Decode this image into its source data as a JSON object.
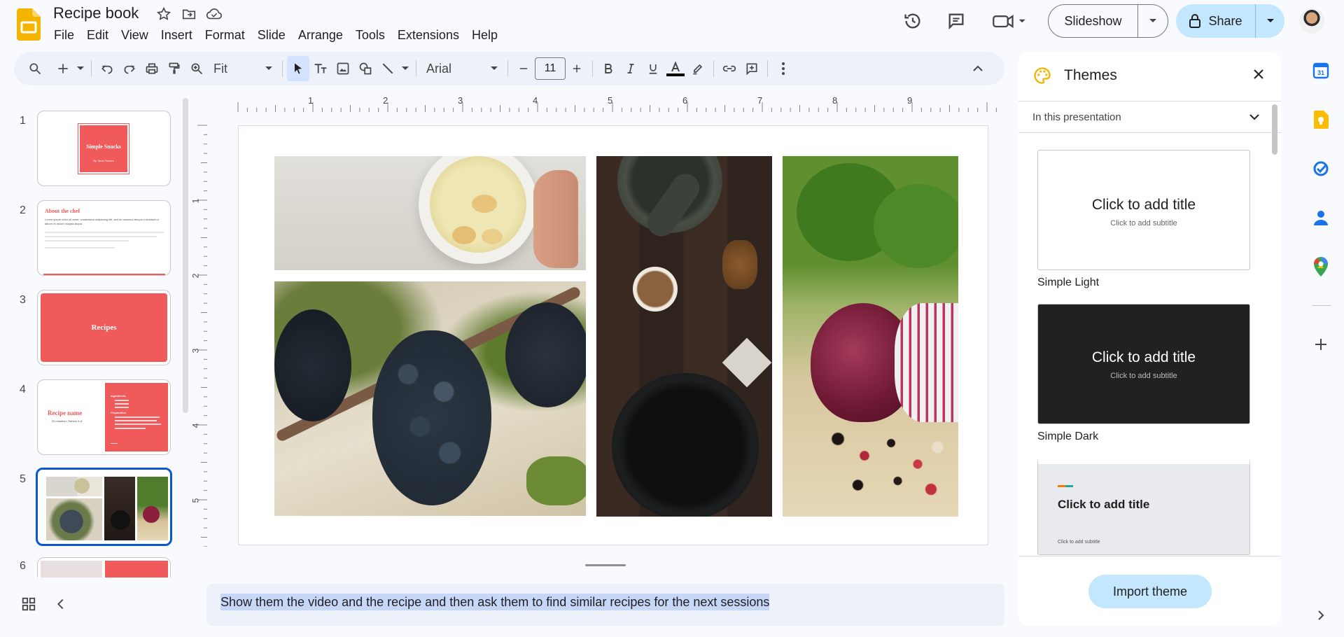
{
  "doc": {
    "title": "Recipe book"
  },
  "menu": [
    "File",
    "Edit",
    "View",
    "Insert",
    "Format",
    "Slide",
    "Arrange",
    "Tools",
    "Extensions",
    "Help"
  ],
  "header": {
    "slideshow_label": "Slideshow",
    "share_label": "Share"
  },
  "toolbar": {
    "zoom": "Fit",
    "font": "Arial",
    "font_size": "11"
  },
  "ruler": {
    "h_ticks": [
      "1",
      "2",
      "3",
      "4",
      "5",
      "6",
      "7",
      "8",
      "9"
    ],
    "v_ticks": [
      "1",
      "2",
      "3",
      "4",
      "5"
    ]
  },
  "filmstrip": {
    "slides": [
      {
        "num": "1",
        "title": "Simple Snacks",
        "sub": "By Taran Soares"
      },
      {
        "num": "2",
        "title": "About the chef",
        "body": "Lorem ipsum dolor sit amet, consectetur adipiscing elit, sed do eiusmod tempor incididunt ut labore et dolore magna aliqua."
      },
      {
        "num": "3",
        "title": "Recipes"
      },
      {
        "num": "4",
        "title": "Recipe name",
        "sub": "20 minutes • Serves 4–6",
        "side_a": "Ingredients",
        "side_b": "Preparation"
      },
      {
        "num": "5"
      },
      {
        "num": "6"
      }
    ]
  },
  "notes": {
    "text": "Show them the video and the recipe and then ask them to find similar recipes for the next sessions"
  },
  "themes": {
    "title": "Themes",
    "section": "In this presentation",
    "cards": [
      {
        "name": "Simple Light",
        "title": "Click to add title",
        "sub": "Click to add subtitle"
      },
      {
        "name": "Simple Dark",
        "title": "Click to add title",
        "sub": "Click to add subtitle"
      },
      {
        "name": "",
        "title": "Click to add title",
        "sub": "Click to add subtitle"
      }
    ],
    "import_label": "Import theme"
  },
  "colors": {
    "accent": "#0b57d0",
    "share_bg": "#c2e7ff",
    "coral": "#f05a5b",
    "toolbar_bg": "#edf2fa"
  }
}
